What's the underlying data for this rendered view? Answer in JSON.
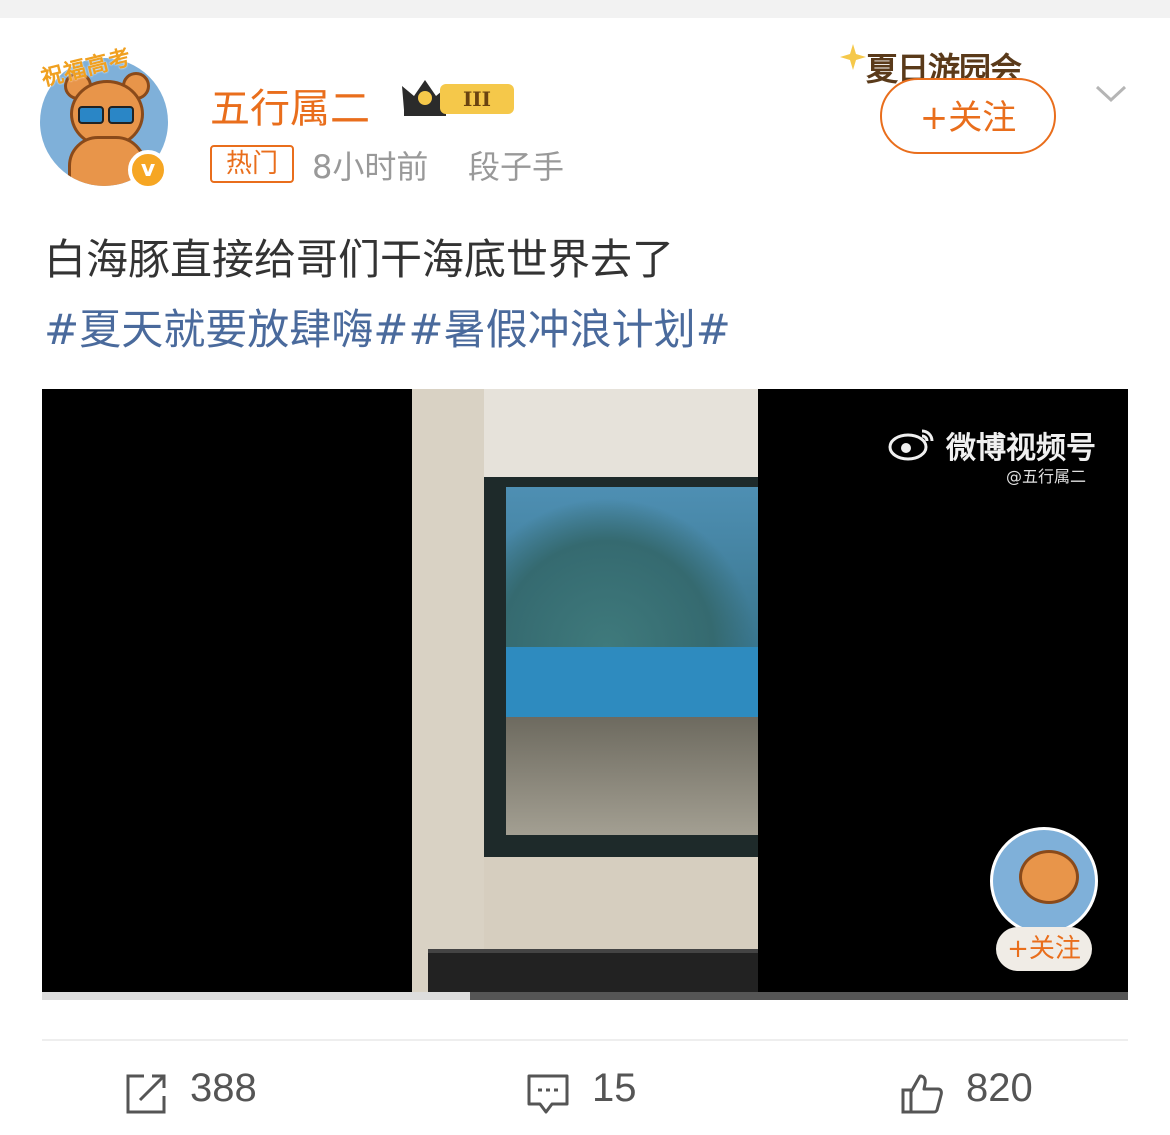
{
  "post": {
    "avatar_banner": "祝福高考",
    "username": "五行属二",
    "level_badge": "III",
    "hot_tag": "热门",
    "time": "8小时前",
    "source": "段子手",
    "summer_badge": "夏日游园会",
    "follow_label": "+关注",
    "text": "白海豚直接给哥们干海底世界去了",
    "hashtags": "#夏天就要放肆嗨##暑假冲浪计划#"
  },
  "video": {
    "watermark_brand": "微博视频号",
    "watermark_user": "@五行属二",
    "follow_label": "+关注",
    "progress": 0.394
  },
  "actions": {
    "share_count": "388",
    "comment_count": "15",
    "like_count": "820"
  },
  "colors": {
    "accent": "#e96e1c",
    "hashtag": "#4a6a9c",
    "meta": "#999999"
  }
}
